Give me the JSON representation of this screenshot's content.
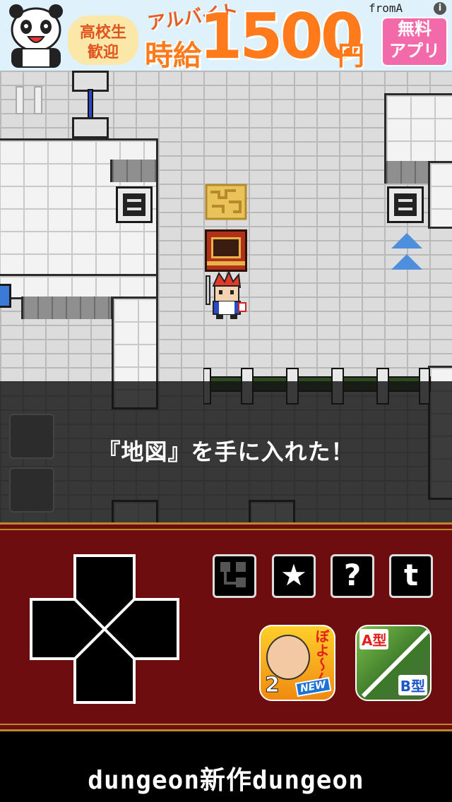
{
  "ad": {
    "badge_line1": "高校生",
    "badge_line2": "歓迎",
    "tag": "アルバイト",
    "pay_label": "時給",
    "amount": "1500",
    "currency": "円",
    "free_line1": "無料",
    "free_line2": "アプリ",
    "brand": "fromA",
    "info_icon": "i"
  },
  "message": "『地図』を手に入れた！",
  "controls": {
    "icons": [
      "map-icon",
      "star-icon",
      "help-icon",
      "twitter-icon"
    ],
    "help_label": "?",
    "twitter_label": "t",
    "star_label": "★"
  },
  "promo_apps": {
    "app1": {
      "kana": "ぼよ〜ん",
      "number": "2",
      "badge": "NEW"
    },
    "app2": {
      "label_a": "A型",
      "label_b": "B型"
    }
  },
  "footer": {
    "logo": "dungeon新作dungeon"
  },
  "colors": {
    "panel": "#6e0d10",
    "trim": "#b98a2b",
    "ad_orange": "#ff7a1a",
    "free_pink": "#f26aaa"
  }
}
